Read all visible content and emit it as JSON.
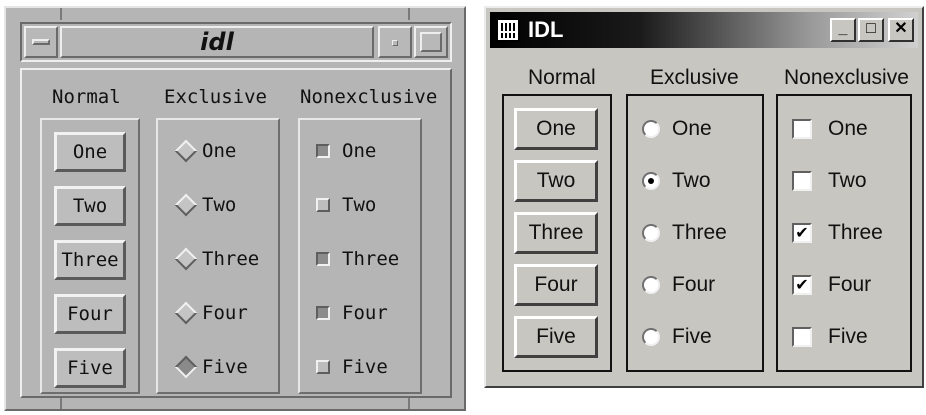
{
  "motif": {
    "title": "idl",
    "columns": {
      "normal": {
        "heading": "Normal",
        "buttons": [
          "One",
          "Two",
          "Three",
          "Four",
          "Five"
        ]
      },
      "exclusive": {
        "heading": "Exclusive",
        "options": [
          "One",
          "Two",
          "Three",
          "Four",
          "Five"
        ],
        "selected": "Five"
      },
      "nonexclusive": {
        "heading": "Nonexclusive",
        "options": [
          "One",
          "Two",
          "Three",
          "Four",
          "Five"
        ],
        "checked": [
          "One",
          "Three",
          "Four"
        ]
      }
    }
  },
  "win": {
    "title": "IDL",
    "controls": {
      "minimize": "_",
      "maximize": "□",
      "close": "✕"
    },
    "columns": {
      "normal": {
        "heading": "Normal",
        "buttons": [
          "One",
          "Two",
          "Three",
          "Four",
          "Five"
        ]
      },
      "exclusive": {
        "heading": "Exclusive",
        "options": [
          "One",
          "Two",
          "Three",
          "Four",
          "Five"
        ],
        "selected": "Two"
      },
      "nonexclusive": {
        "heading": "Nonexclusive",
        "options": [
          "One",
          "Two",
          "Three",
          "Four",
          "Five"
        ],
        "checked": [
          "Three",
          "Four"
        ]
      }
    }
  },
  "icons": {
    "check_glyph": "✔"
  },
  "colors": {
    "motif_bg": "#b5b5b5",
    "win_bg": "#c8c6c0",
    "win_title_start": "#000000",
    "win_title_end": "#d0d0d0"
  }
}
